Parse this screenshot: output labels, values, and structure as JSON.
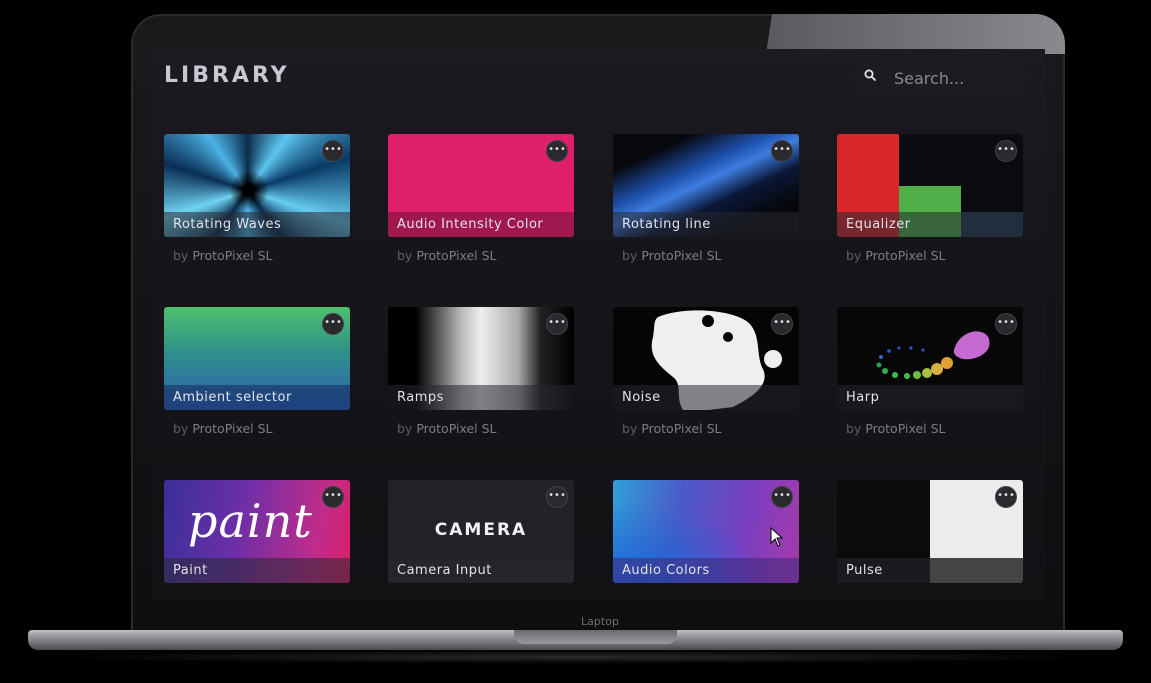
{
  "app": {
    "title": "LIBRARY"
  },
  "search": {
    "placeholder": "Search..."
  },
  "device": {
    "label": "Laptop"
  },
  "more_glyph": "•••",
  "byline": {
    "prefix": "by",
    "author": "ProtoPixel SL"
  },
  "cards": [
    {
      "name": "Rotating Waves",
      "thumb": "rotating-waves",
      "has_byline": true
    },
    {
      "name": "Audio Intensity Color",
      "thumb": "pink-solid",
      "has_byline": true
    },
    {
      "name": "Rotating line",
      "thumb": "blue-diagonal-line",
      "has_byline": true
    },
    {
      "name": "Equalizer",
      "thumb": "equalizer-bars",
      "has_byline": true
    },
    {
      "name": "Ambient selector",
      "thumb": "green-blue-gradient",
      "has_byline": true
    },
    {
      "name": "Ramps",
      "thumb": "grey-ramp",
      "has_byline": true
    },
    {
      "name": "Noise",
      "thumb": "white-blobs",
      "has_byline": true
    },
    {
      "name": "Harp",
      "thumb": "colored-particles",
      "has_byline": true
    },
    {
      "name": "Paint",
      "thumb": "paint-script",
      "has_byline": false,
      "thumb_text": "paint"
    },
    {
      "name": "Camera Input",
      "thumb": "camera",
      "has_byline": false,
      "thumb_text": "CAMERA"
    },
    {
      "name": "Audio Colors",
      "thumb": "blue-purple-gradient",
      "has_byline": false
    },
    {
      "name": "Pulse",
      "thumb": "white-square",
      "has_byline": false
    }
  ],
  "colors": {
    "accent_pink": "#df1f6a",
    "eq_red": "#d8262a",
    "eq_green": "#4fb04a",
    "eq_blue": "#1c3350"
  }
}
